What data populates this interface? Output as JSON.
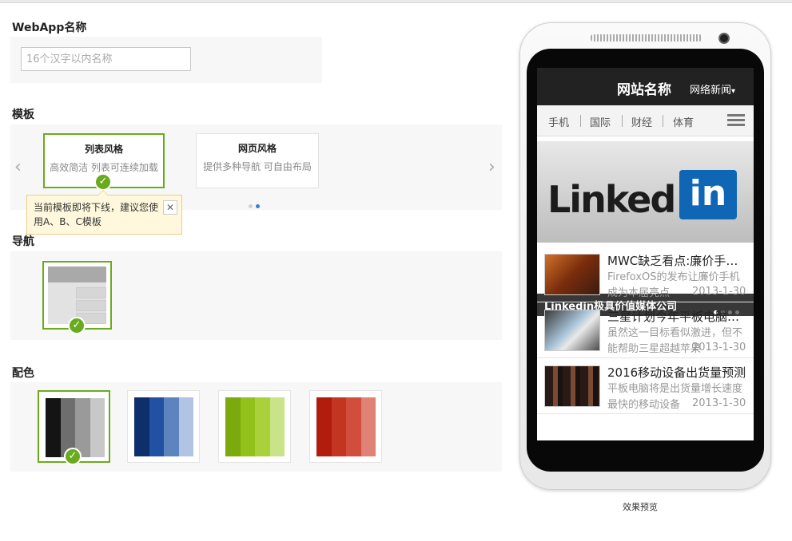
{
  "appname": {
    "label": "WebApp名称",
    "placeholder": "16个汉字以内名称"
  },
  "template": {
    "label": "模板",
    "prev_arrow": "‹",
    "next_arrow": "›",
    "cards": [
      {
        "title": "列表风格",
        "desc": "高效简洁  列表可连续加载",
        "selected": true
      },
      {
        "title": "网页风格",
        "desc": "提供多种导航  可自由布局",
        "selected": false
      }
    ],
    "tooltip": {
      "text": "当前模板即将下线，建议您使用A、B、C模板",
      "close": "✕"
    }
  },
  "nav": {
    "label": "导航"
  },
  "colors": {
    "label": "配色",
    "palettes": [
      {
        "swatches": [
          "#141414",
          "#6e6e6e",
          "#9a9a9a",
          "#c8c8c8"
        ],
        "selected": true
      },
      {
        "swatches": [
          "#0d2f6b",
          "#2151a0",
          "#5d84bf",
          "#b1c4e3"
        ],
        "selected": false
      },
      {
        "swatches": [
          "#7aaa0b",
          "#92c11b",
          "#a9d23a",
          "#c9e488"
        ],
        "selected": false
      },
      {
        "swatches": [
          "#b11c0c",
          "#c33421",
          "#d14e3c",
          "#e08275"
        ],
        "selected": false
      }
    ]
  },
  "preview": {
    "site_title": "网站名称",
    "menu_label": "网络新闻",
    "menu_caret": "▾",
    "tabs": [
      "手机",
      "国际",
      "财经",
      "体育"
    ],
    "banner": {
      "logo_text": "Linked",
      "logo_box": "in",
      "caption": "Linkedin极具价值媒体公司"
    },
    "news": [
      {
        "title": "MWC缺乏看点:廉价手机成主流",
        "desc": "FirefoxOS的发布让廉价手机成为本届亮点",
        "date": "2013-1-30"
      },
      {
        "title": "三星计划今年平板电脑出货翻番",
        "desc": "虽然这一目标看似激进，但不能帮助三星超越苹果",
        "date": "2013-1-30"
      },
      {
        "title": "2016移动设备出货量预测",
        "desc": "平板电脑将是出货量增长速度最快的移动设备",
        "date": "2013-1-30"
      }
    ],
    "caption": "效果预览"
  }
}
